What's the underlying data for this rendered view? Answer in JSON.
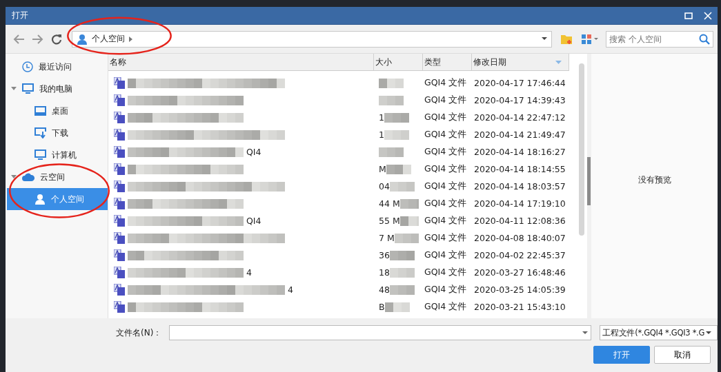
{
  "window": {
    "title": "打开"
  },
  "toolbar": {
    "path": "个人空间",
    "search": {
      "placeholder": "搜索 个人空间"
    }
  },
  "sidebar": {
    "items": [
      {
        "label": "最近访问",
        "selected": false
      },
      {
        "label": "我的电脑",
        "selected": false,
        "expanded": true,
        "children": [
          {
            "label": "桌面",
            "selected": false
          },
          {
            "label": "下载",
            "selected": false
          },
          {
            "label": "计算机",
            "selected": false
          }
        ]
      },
      {
        "label": "云空间",
        "selected": false,
        "expanded": true,
        "children": [
          {
            "label": "个人空间",
            "selected": true
          }
        ]
      }
    ]
  },
  "table": {
    "columns": [
      "名称",
      "大小",
      "类型",
      "修改日期"
    ],
    "rows": [
      {
        "name_tail": "",
        "size_head": "",
        "type": "GQI4 文件",
        "modified": "2020-04-17 17:46:44"
      },
      {
        "name_tail": "",
        "size_head": "",
        "type": "GQI4 文件",
        "modified": "2020-04-17 14:39:43"
      },
      {
        "name_tail": "",
        "size_head": "1",
        "type": "GQI4 文件",
        "modified": "2020-04-14 22:47:12"
      },
      {
        "name_tail": "",
        "size_head": "1",
        "type": "GQI4 文件",
        "modified": "2020-04-14 21:49:47"
      },
      {
        "name_tail": "QI4",
        "size_head": "",
        "type": "GQI4 文件",
        "modified": "2020-04-14 18:16:27"
      },
      {
        "name_tail": "",
        "size_head": "M",
        "type": "GQI4 文件",
        "modified": "2020-04-14 18:14:55"
      },
      {
        "name_tail": "",
        "size_head": "04",
        "type": "GQI4 文件",
        "modified": "2020-04-14 18:03:57"
      },
      {
        "name_tail": "",
        "size_head": "44 M",
        "type": "GQI4 文件",
        "modified": "2020-04-14 17:19:10"
      },
      {
        "name_tail": "QI4",
        "size_head": "55 M",
        "type": "GQI4 文件",
        "modified": "2020-04-11 12:08:36"
      },
      {
        "name_tail": "",
        "size_head": "7 M",
        "type": "GQI4 文件",
        "modified": "2020-04-08 18:40:07"
      },
      {
        "name_tail": "",
        "size_head": "36",
        "type": "GQI4 文件",
        "modified": "2020-04-02 22:45:37"
      },
      {
        "name_tail": "4",
        "size_head": "18",
        "type": "GQI4 文件",
        "modified": "2020-03-27 16:48:46"
      },
      {
        "name_tail": "4",
        "size_head": "48",
        "type": "GQI4 文件",
        "modified": "2020-03-25 14:05:39"
      },
      {
        "name_tail": "",
        "size_head": "B",
        "type": "GQI4 文件",
        "modified": "2020-03-21 15:43:10"
      }
    ]
  },
  "preview": {
    "text": "没有预览"
  },
  "footer": {
    "filename_label": "文件名(N)：",
    "filter": "工程文件(*.GQI4 *.GQI3 *.G",
    "buttons": [
      "打开",
      "取消"
    ]
  },
  "annotations": [
    {
      "kind": "ellipse"
    },
    {
      "kind": "ellipse"
    }
  ]
}
